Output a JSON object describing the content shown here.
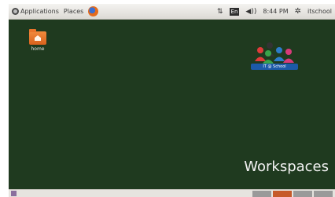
{
  "top_panel": {
    "applications_label": "Applications",
    "places_label": "Places",
    "language_badge": "En",
    "clock": "8:44 PM",
    "user": "itschool"
  },
  "desktop": {
    "home_icon_label": "home",
    "logo_text": "IT @ School",
    "workspaces_label": "Workspaces"
  },
  "bottom_panel": {
    "workspaces": [
      {
        "color": "#9a9a9a"
      },
      {
        "color": "#c65a2a"
      },
      {
        "color": "#9a9a9a"
      },
      {
        "color": "#9a9a9a"
      }
    ]
  }
}
